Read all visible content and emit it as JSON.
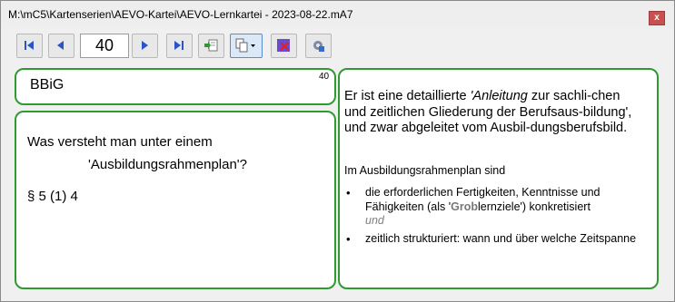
{
  "window": {
    "title": "M:\\mC5\\Kartenserien\\AEVO-Kartei\\AEVO-Lernkartei - 2023-08-22.mA7",
    "close_label": "x"
  },
  "toolbar": {
    "card_number": "40",
    "buttons": [
      "first-icon",
      "prev-icon",
      "next-icon",
      "last-icon",
      "import-icon",
      "copy-icon",
      "delete-icon",
      "settings-icon"
    ]
  },
  "card": {
    "topic": "BBiG",
    "number": "40",
    "question_line1": "Was versteht man unter einem",
    "question_line2": "'Ausbildungsrahmenplan'?",
    "reference": "§ 5 (1) 4",
    "answer_intro_a": "Er ist eine detaillierte ",
    "answer_intro_em": "'Anleitung",
    "answer_intro_b": " zur sachli-chen und zeitlichen Gliederung der Berufsaus-bildung', und zwar abgeleitet vom Ausbil-dungsberufsbild.",
    "answer_sub": "Im Ausbildungsrahmenplan sind",
    "bullet1_a": "die erforderlichen Fertigkeiten, Kenntnisse und Fähigkeiten (als '",
    "bullet1_grey": "Grob",
    "bullet1_b": "lernziele') konkretisiert",
    "connector": "und",
    "bullet2": "zeitlich strukturiert: wann und über welche Zeitspanne"
  }
}
